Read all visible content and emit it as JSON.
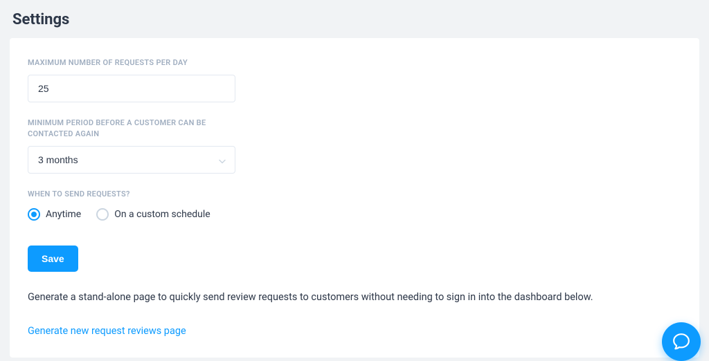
{
  "page": {
    "title": "Settings"
  },
  "form": {
    "max_requests": {
      "label": "MAXIMUM NUMBER OF REQUESTS PER DAY",
      "value": "25"
    },
    "min_period": {
      "label": "MINIMUM PERIOD BEFORE A CUSTOMER CAN BE CONTACTED AGAIN",
      "value": "3 months"
    },
    "when_send": {
      "label": "WHEN TO SEND REQUESTS?",
      "options": {
        "anytime": "Anytime",
        "custom": "On a custom schedule"
      },
      "selected": "anytime"
    },
    "save_label": "Save",
    "description": "Generate a stand-alone page to quickly send review requests to customers without needing to sign in into the dashboard below.",
    "generate_link": "Generate new request reviews page"
  }
}
